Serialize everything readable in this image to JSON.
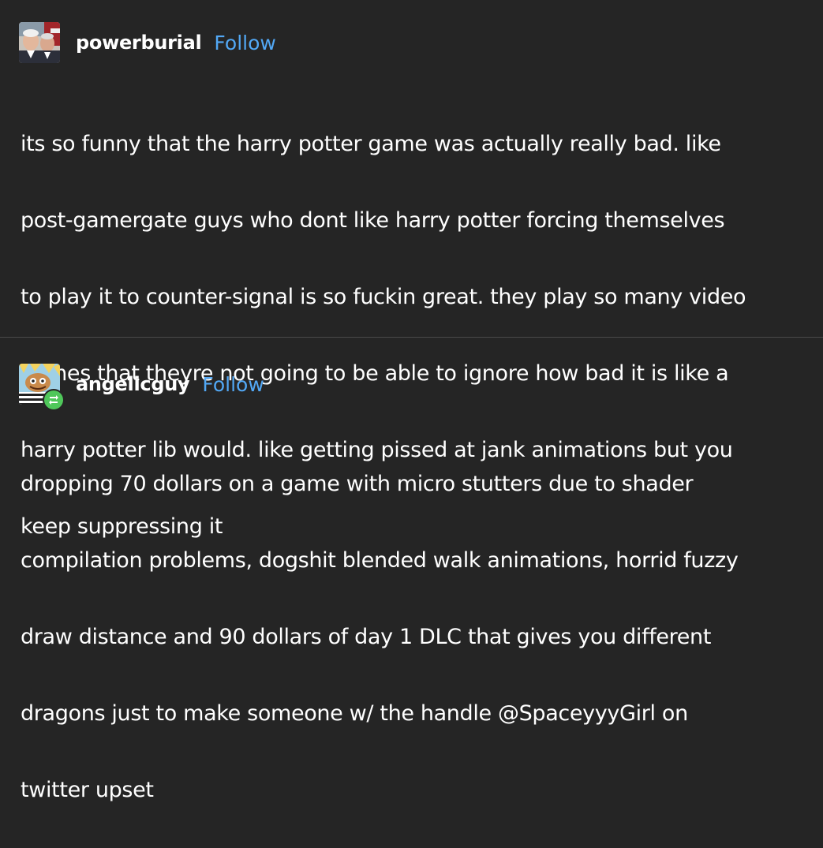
{
  "posts": [
    {
      "username": "powerburial",
      "follow_label": "Follow",
      "avatar_icon": "avatar-portrait-icon",
      "body_lines": [
        "its so funny that the harry potter game was actually really bad. like",
        "post-gamergate guys who dont like harry potter forcing themselves",
        "to play it to counter-signal is so fuckin great. they play so many video",
        "games that theyre not going to be able to ignore how bad it is like a",
        "harry potter lib would. like getting pissed at jank animations but you",
        "keep suppressing it"
      ]
    },
    {
      "username": "angelicguy",
      "follow_label": "Follow",
      "avatar_icon": "avatar-cartoon-icon",
      "badge_icon": "reblog-icon",
      "body_lines": [
        "dropping 70 dollars on a game with micro stutters due to shader",
        "compilation problems, dogshit blended walk animations, horrid fuzzy",
        "draw distance and 90 dollars of day 1 DLC that gives you different",
        "dragons just to make someone w/ the handle @SpaceyyyGirl on",
        "twitter upset"
      ]
    }
  ],
  "colors": {
    "background": "#252525",
    "text": "#ffffff",
    "link": "#52a8f5",
    "divider": "#4a4a4a",
    "reblog_badge": "#4fc75a"
  }
}
